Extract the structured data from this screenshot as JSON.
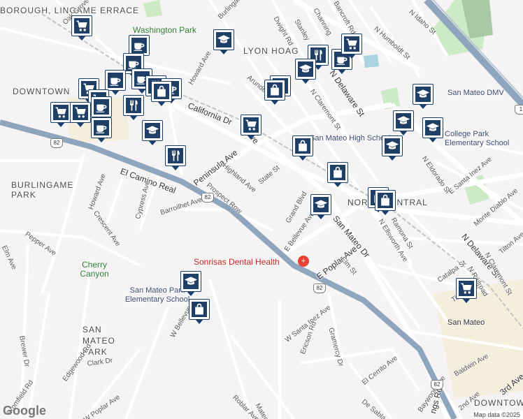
{
  "map": {
    "areas": [
      {
        "text": "BURLINGAME PARK",
        "id": "area-burlingame-park"
      },
      {
        "text": "DOWNTOWN",
        "id": "area-downtown-nw"
      },
      {
        "text": "LYON HOAG",
        "id": "area-lyon-hoag"
      },
      {
        "text": "NORTH CENTRAL",
        "id": "area-north-central"
      },
      {
        "text": "SAN MATEO PARK",
        "id": "area-san-mateo-park"
      },
      {
        "text": "DOWNTOWN",
        "id": "area-downtown-se"
      },
      {
        "text": "BOROUGH, LINGAME ERRACE",
        "id": "area-borough"
      }
    ],
    "places": [
      {
        "text": "Washington Park",
        "id": "place-washington-park"
      },
      {
        "text": "Cherry Canyon",
        "id": "place-cherry-canyon"
      },
      {
        "text": "San Mateo Park Elementary School",
        "id": "place-smp-elementary"
      },
      {
        "text": "College Park Elementary School",
        "id": "place-college-park"
      },
      {
        "text": "San Mateo DMV",
        "id": "place-dmv"
      },
      {
        "text": "San Mateo High School",
        "id": "place-smhs"
      },
      {
        "text": "Sonrisas Dental Health",
        "id": "place-sonrisas"
      },
      {
        "text": "San Mateo",
        "id": "place-san-mateo-station"
      }
    ],
    "streets": [
      "El Camino Real",
      "Peninsula Ave",
      "San Mateo Dr",
      "California Dr",
      "N Delaware St",
      "E Poplar Ave",
      "Howard Ave",
      "Crescent Ave",
      "Cypress Ave",
      "Barroilhet Ave",
      "Prospect Row",
      "Highland Ave",
      "State St",
      "Grand Blvd",
      "E Bellevue Ave",
      "Elm St",
      "Oak Grove Ave",
      "Burlingame",
      "Dwight Rd",
      "Stanley",
      "Channing",
      "Bancroft Rd",
      "N Idaho St",
      "N Humboldt St",
      "N Claremont St",
      "Arundel",
      "N Eldorado St",
      "E Santa Inez Ave",
      "Monte Diablo Ave",
      "Tilton Ave",
      "N Railroad",
      "N Ellsworth Ave",
      "Ramona St",
      "Catalpa St",
      "Pepper Ave",
      "Elm Ave",
      "Brewer Dr",
      "Bromfield Rd",
      "Edgewood Rd",
      "Clark Dr",
      "W Bellevue",
      "W Santa Inez Ave",
      "Ericson Rd",
      "Gramercy Dr",
      "El Cerrito Ave",
      "De Sabla Rd",
      "Baywood Ave",
      "Baldwin Ave",
      "2nd Ave",
      "3rd Ave",
      "W Poplar Ave",
      "Roblar Ave",
      "Mateo",
      "N San Mateo",
      "Lo",
      "Ave",
      "Rd",
      "Ave",
      "ngs Rd",
      "Ave"
    ],
    "highway_shield": "82",
    "attribution": "Map data ©2025",
    "logo": "Google"
  },
  "colors": {
    "pin_fill": "#1f3f66",
    "pin_border": "#1a3e6e",
    "highway": "#8fa5be",
    "park": "#cdeac6",
    "hospital": "#e94235"
  },
  "icon_kinds": [
    "cart-icon",
    "coffee-icon",
    "shopping-bag-icon",
    "graduation-cap-icon",
    "restaurant-icon"
  ]
}
